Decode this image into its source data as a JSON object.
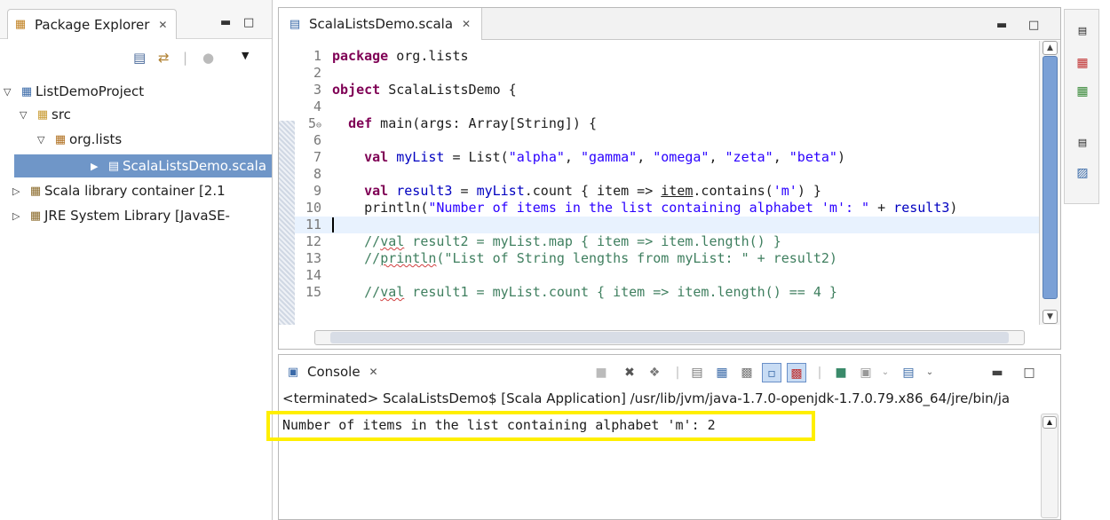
{
  "package_explorer": {
    "title": "Package Explorer",
    "tree": [
      {
        "label": "ListDemoProject",
        "depth": 0,
        "expanded": true
      },
      {
        "label": "src",
        "depth": 1,
        "expanded": true
      },
      {
        "label": "org.lists",
        "depth": 2,
        "expanded": true
      },
      {
        "label": "ScalaListsDemo.scala",
        "depth": 3,
        "selected": true
      },
      {
        "label": "Scala library container [2.1",
        "depth": 0
      },
      {
        "label": "JRE System Library [JavaSE-",
        "depth": 0
      }
    ]
  },
  "editor": {
    "tab_title": "ScalaListsDemo.scala",
    "line_numbers": [
      "1",
      "2",
      "3",
      "4",
      "5",
      "6",
      "7",
      "8",
      "9",
      "10",
      "11",
      "12",
      "13",
      "14",
      "15"
    ],
    "lines": {
      "l1_kw": "package",
      "l1_rest": " org.lists",
      "l3_kw": "object",
      "l3_rest": " ScalaListsDemo {",
      "l5_kw": "def",
      "l5_rest": " main(args: Array[String]) {",
      "l7_kw": "val",
      "l7_var": "myList",
      "l7_mid": " = List(",
      "l7_s1": "\"alpha\"",
      "l7_s2": "\"gamma\"",
      "l7_s3": "\"omega\"",
      "l7_s4": "\"zeta\"",
      "l7_s5": "\"beta\"",
      "l7_end": ")",
      "l9_kw": "val",
      "l9_var": "result3",
      "l9_eq": " = ",
      "l9_var2": "myList",
      "l9_mid": ".count { item => ",
      "l9_item": "item",
      "l9_contains": ".contains(",
      "l9_char": "'m'",
      "l9_end": ") }",
      "l10_pre": "println(",
      "l10_str": "\"Number of items in the list containing alphabet 'm': \"",
      "l10_plus": " + ",
      "l10_var": "result3",
      "l10_end": ")",
      "l12_a": "//",
      "l12_b": "val",
      "l12_c": " result2 = myList.map { item => item.length() }",
      "l13_a": "//",
      "l13_b": "println",
      "l13_c": "(\"List of String lengths from myList: \" + result2)",
      "l15_a": "//",
      "l15_b": "val",
      "l15_c": " result1 = myList.count { item => item.length() == 4 }"
    }
  },
  "console": {
    "title": "Console",
    "status": "<terminated> ScalaListsDemo$ [Scala Application] /usr/lib/jvm/java-1.7.0-openjdk-1.7.0.79.x86_64/jre/bin/ja",
    "output": "Number of items in the list containing alphabet 'm': 2"
  },
  "colors": {
    "keyword": "#7f0055",
    "string": "#2a00ff",
    "field": "#0000c0",
    "comment": "#3f7f5f",
    "selection": "#6f96c8",
    "highlight_box": "#ffef00"
  }
}
